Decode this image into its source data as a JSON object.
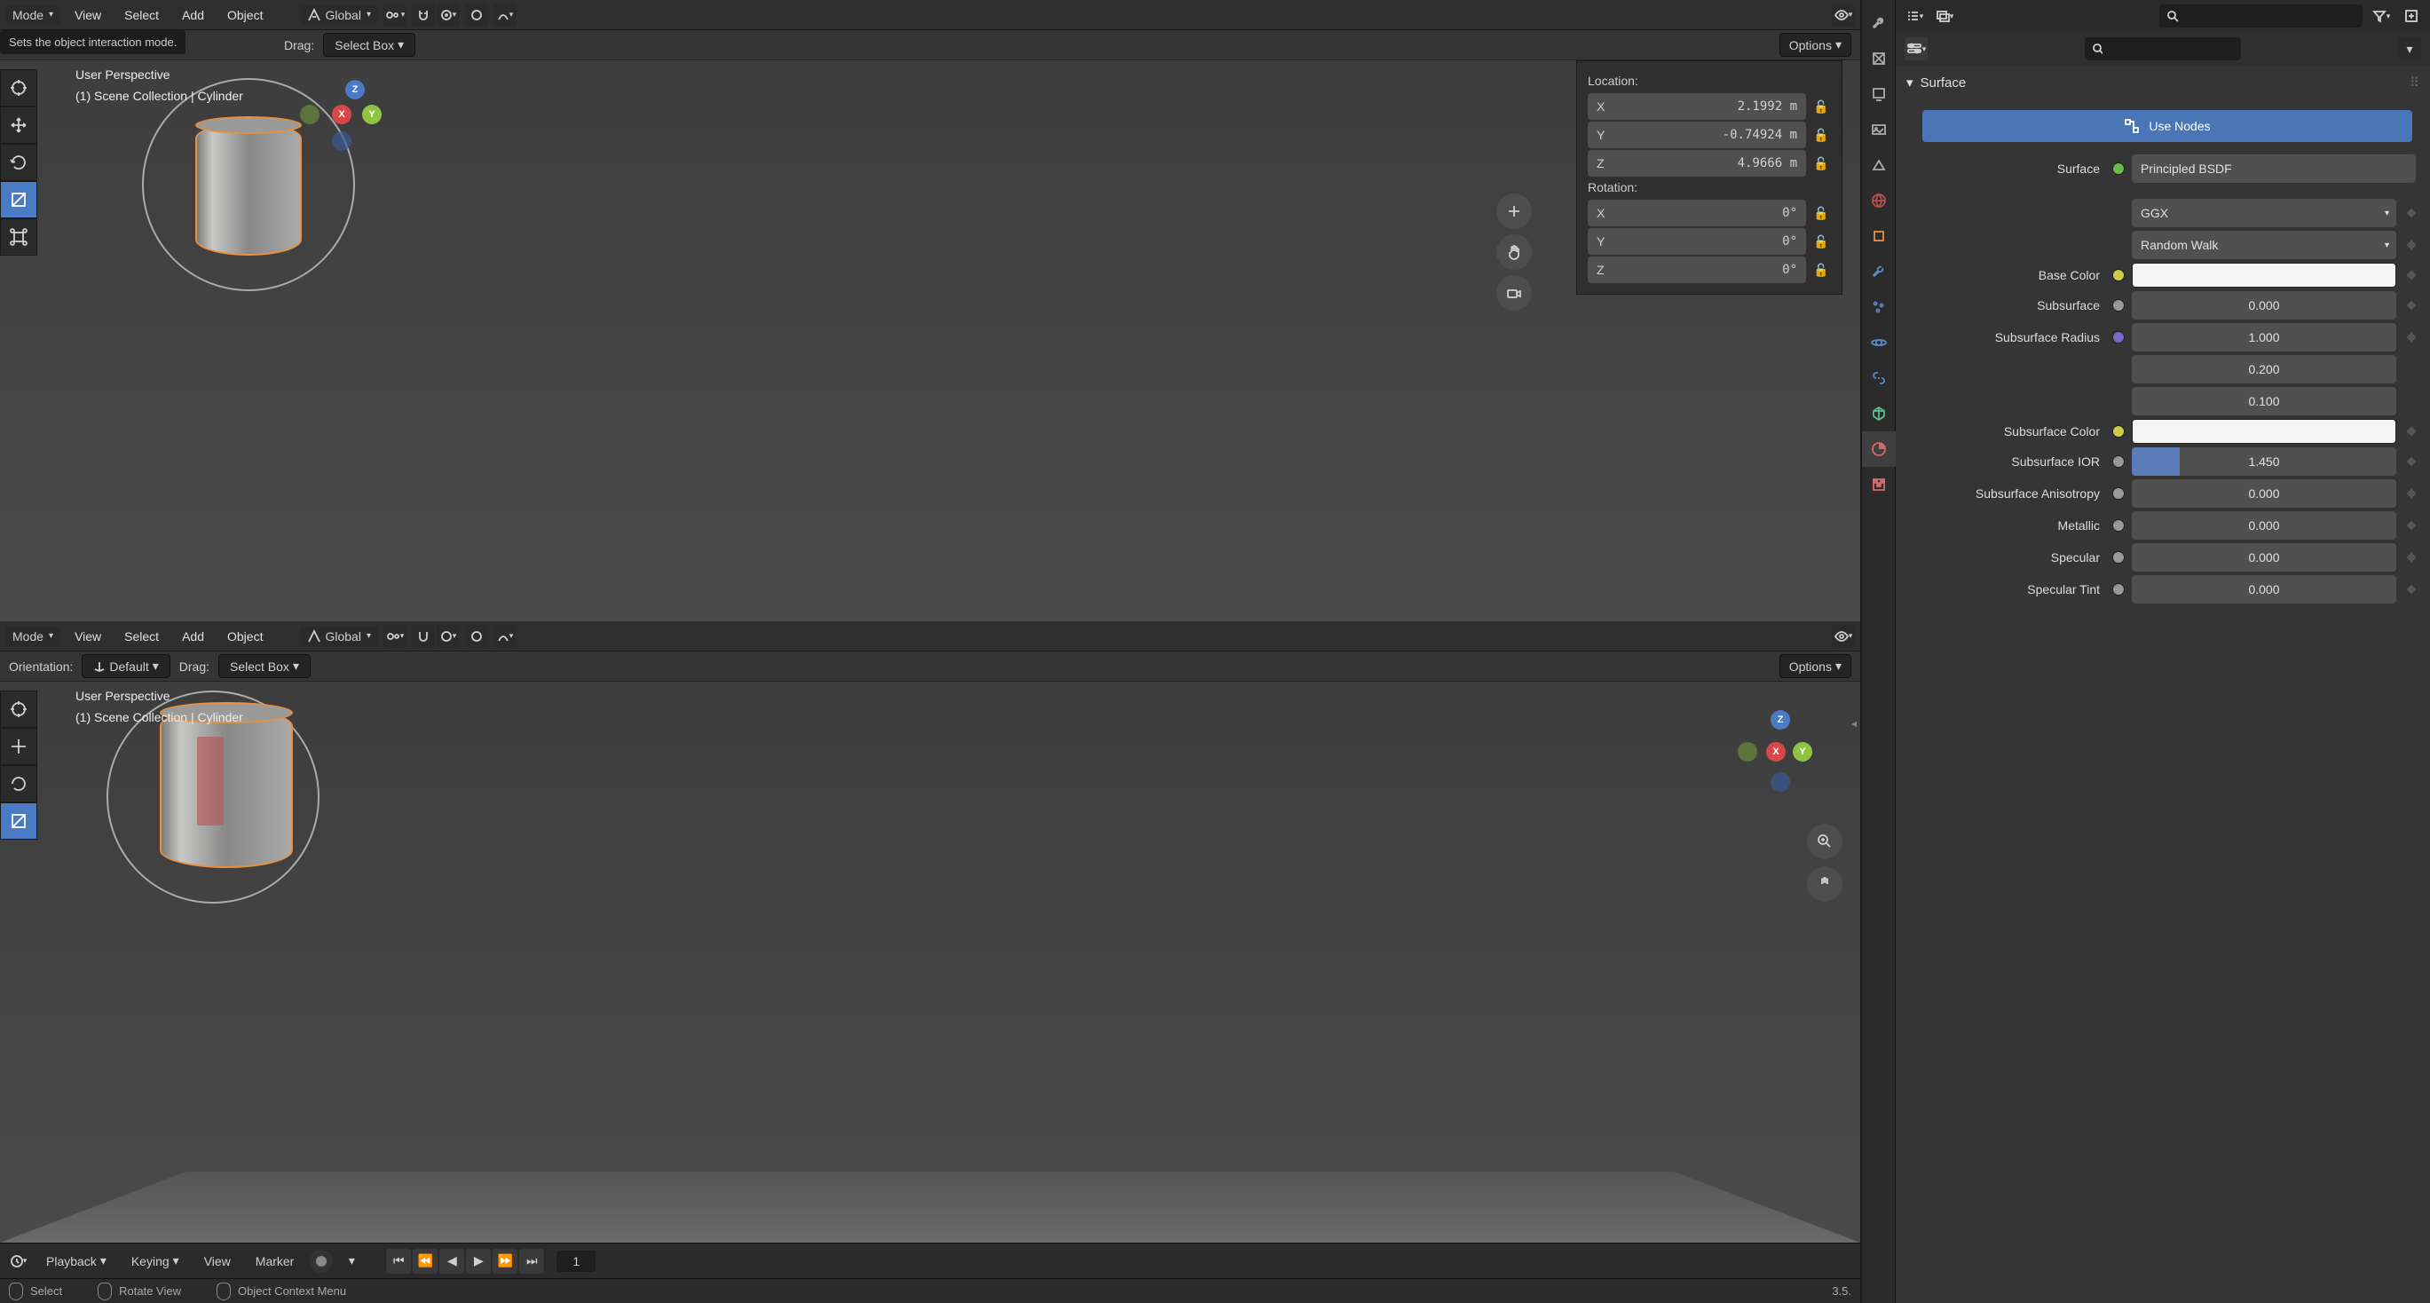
{
  "topbar": {
    "mode_label": "Mode",
    "menu": {
      "view": "View",
      "select": "Select",
      "add": "Add",
      "object": "Object"
    },
    "orientation": "Global",
    "tooltip": "Sets the object interaction mode."
  },
  "secondbar": {
    "drag_label": "Drag:",
    "select_box": "Select Box",
    "orientation_label": "Orientation:",
    "orientation_value": "Default",
    "options": "Options"
  },
  "viewport": {
    "perspective": "User Perspective",
    "path": "(1) Scene Collection | Cylinder"
  },
  "transform": {
    "location_label": "Location:",
    "rotation_label": "Rotation:",
    "x": {
      "axis": "X",
      "val": "2.1992 m",
      "rot": "0°"
    },
    "y": {
      "axis": "Y",
      "val": "-0.74924 m",
      "rot": "0°"
    },
    "z": {
      "axis": "Z",
      "val": "4.9666 m",
      "rot": "0°"
    }
  },
  "timeline": {
    "playback": "Playback",
    "keying": "Keying",
    "view": "View",
    "marker": "Marker",
    "frame": "1"
  },
  "status": {
    "select": "Select",
    "rotate": "Rotate View",
    "context": "Object Context Menu",
    "version": "3.5."
  },
  "props": {
    "surface_header": "Surface",
    "use_nodes": "Use Nodes",
    "surface_label": "Surface",
    "surface_value": "Principled BSDF",
    "distribution": "GGX",
    "subsurface_method": "Random Walk",
    "base_color_label": "Base Color",
    "subsurface_label": "Subsurface",
    "subsurface_val": "0.000",
    "subsurface_radius_label": "Subsurface Radius",
    "radius1": "1.000",
    "radius2": "0.200",
    "radius3": "0.100",
    "subsurface_color_label": "Subsurface Color",
    "subsurface_ior_label": "Subsurface IOR",
    "subsurface_ior_val": "1.450",
    "subsurface_aniso_label": "Subsurface Anisotropy",
    "subsurface_aniso_val": "0.000",
    "metallic_label": "Metallic",
    "metallic_val": "0.000",
    "specular_label": "Specular",
    "specular_val": "0.000",
    "specular_tint_label": "Specular Tint",
    "specular_tint_val": "0.000"
  }
}
